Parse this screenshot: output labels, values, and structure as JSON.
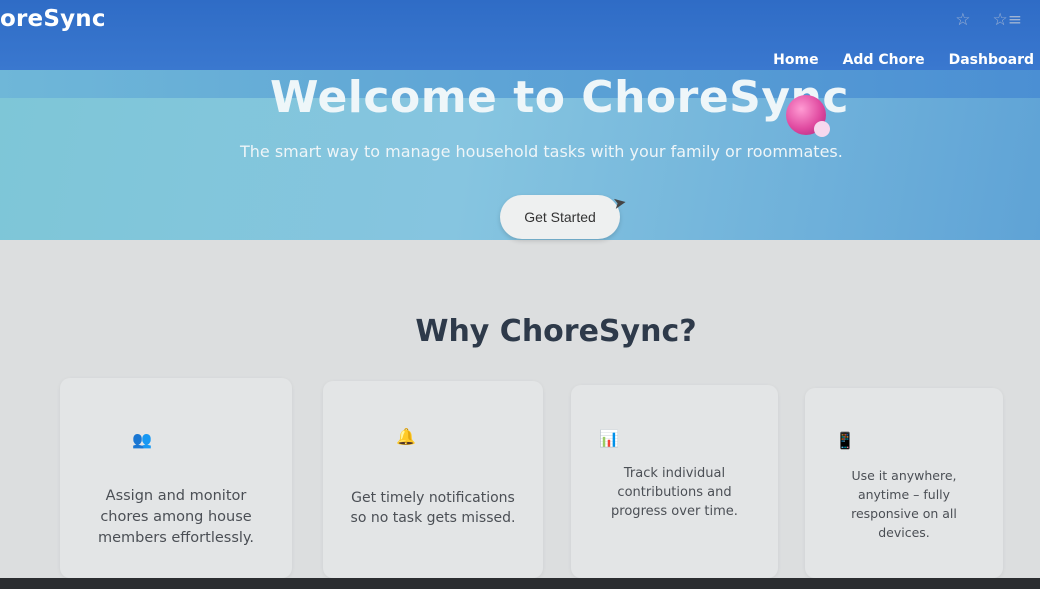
{
  "brand": "oreSync",
  "browser_icons": [
    "star-icon",
    "favorites-icon"
  ],
  "nav": {
    "links": [
      "Home",
      "Add Chore",
      "Dashboard"
    ]
  },
  "hero": {
    "title": "Welcome to ChoreSync",
    "emoji": "sparkles-ball-icon",
    "subtitle": "The smart way to manage household tasks with your family or roommates.",
    "cta_label": "Get Started"
  },
  "features": {
    "title": "Why ChoreSync?",
    "cards": [
      {
        "icon": "people-icon",
        "text": "Assign and monitor chores among house members effortlessly."
      },
      {
        "icon": "bell-icon",
        "text": "Get timely notifications so no task gets missed."
      },
      {
        "icon": "chart-icon",
        "text": "Track individual contributions and progress over time."
      },
      {
        "icon": "mobile-icon",
        "text": "Use it anywhere, anytime – fully responsive on all devices."
      }
    ]
  },
  "colors": {
    "navbar": "#2f6cc6",
    "hero": "#7ec6d7",
    "page_bg": "#dcdedf",
    "heading": "#2e3a4a"
  }
}
